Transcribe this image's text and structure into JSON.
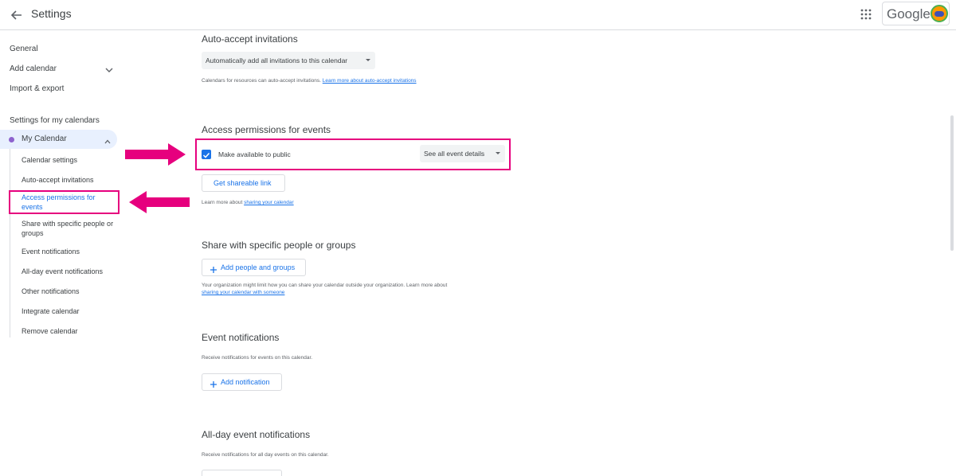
{
  "header": {
    "title": "Settings",
    "brand": "Google"
  },
  "sidebar": {
    "items": [
      {
        "label": "General"
      },
      {
        "label": "Add calendar"
      },
      {
        "label": "Import & export"
      }
    ],
    "section_label": "Settings for my calendars",
    "calendar": {
      "label": "My Calendar",
      "color": "#8e63ce"
    },
    "sub_items": [
      {
        "label": "Calendar settings"
      },
      {
        "label": "Auto-accept invitations"
      },
      {
        "label": "Access permissions for events"
      },
      {
        "label": "Share with specific people or groups"
      },
      {
        "label": "Event notifications"
      },
      {
        "label": "All-day event notifications"
      },
      {
        "label": "Other notifications"
      },
      {
        "label": "Integrate calendar"
      },
      {
        "label": "Remove calendar"
      }
    ],
    "active_item": "Access permissions for events"
  },
  "main": {
    "auto_accept": {
      "title": "Auto-accept invitations",
      "select_value": "Automatically add all invitations to this calendar",
      "help_text": "Calendars for resources can auto-accept invitations. ",
      "help_link": "Learn more about auto-accept invitations"
    },
    "access": {
      "title": "Access permissions for events",
      "checkbox_label": "Make available to public",
      "checkbox_checked": true,
      "detail_select_value": "See all event details",
      "shareable_button": "Get shareable link",
      "help_text": "Learn more about ",
      "help_link": "sharing your calendar"
    },
    "share": {
      "title": "Share with specific people or groups",
      "add_button": "Add people and groups",
      "help_text": "Your organization might limit how you can share your calendar outside your organization. Learn more about",
      "help_link": "sharing your calendar with someone"
    },
    "event_notifications": {
      "title": "Event notifications",
      "help_text": "Receive notifications for events on this calendar.",
      "add_button": "Add notification"
    },
    "allday_notifications": {
      "title": "All-day event notifications",
      "help_text": "Receive notifications for all day events on this calendar."
    }
  },
  "colors": {
    "accent": "#1a73e8",
    "highlight": "#e6007e",
    "active_bg": "#e8f0fe"
  }
}
